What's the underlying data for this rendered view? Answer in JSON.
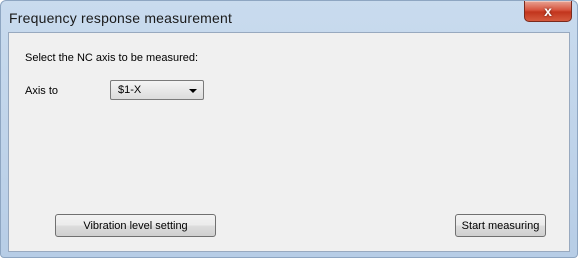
{
  "window": {
    "title": "Frequency response measurement",
    "close_label": "x"
  },
  "form": {
    "instruction": "Select the NC axis to be measured:",
    "axis_label": "Axis to",
    "axis_selected": "$1-X"
  },
  "buttons": {
    "vibration_level": "Vibration level setting",
    "start_measuring": "Start measuring"
  },
  "icons": {
    "close": "close-icon",
    "dropdown": "chevron-down-icon"
  },
  "colors": {
    "titlebar": "#c9dbee",
    "close_button": "#c2351d",
    "client_bg": "#f0f0f0"
  }
}
